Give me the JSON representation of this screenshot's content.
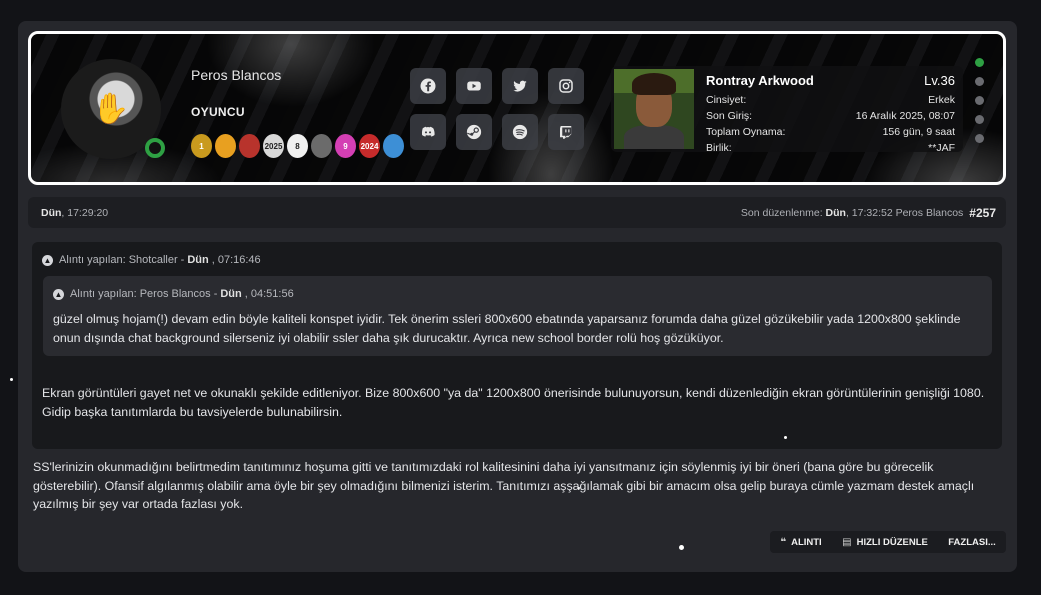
{
  "profile": {
    "username": "Peros Blancos",
    "rank": "OYUNCU",
    "badges": [
      {
        "color": "#c99a1e",
        "label": "1"
      },
      {
        "color": "#e8a020",
        "label": ""
      },
      {
        "color": "#b8332c",
        "label": ""
      },
      {
        "color": "#d8d8d8",
        "label": "2025"
      },
      {
        "color": "#f0f0f0",
        "label": "8"
      },
      {
        "color": "#6b6b6b",
        "label": ""
      },
      {
        "color": "#d43fb4",
        "label": "9"
      },
      {
        "color": "#c62b2b",
        "label": "2024"
      },
      {
        "color": "#3d8fd6",
        "label": ""
      }
    ]
  },
  "socials": [
    {
      "name": "facebook-icon"
    },
    {
      "name": "youtube-icon"
    },
    {
      "name": "twitter-icon"
    },
    {
      "name": "instagram-icon"
    },
    {
      "name": "discord-icon"
    },
    {
      "name": "steam-icon"
    },
    {
      "name": "spotify-icon"
    },
    {
      "name": "twitch-icon"
    }
  ],
  "character": {
    "name": "Rontray Arkwood",
    "level": "Lv.36",
    "rows": [
      {
        "label": "Cinsiyet:",
        "value": "Erkek"
      },
      {
        "label": "Son Giriş:",
        "value": "16 Aralık 2025, 08:07"
      },
      {
        "label": "Toplam Oynama:",
        "value": "156 gün, 9 saat"
      },
      {
        "label": "Birlik:",
        "value": "**JAF"
      }
    ]
  },
  "meta": {
    "date_bold": "Dün",
    "date_time": ", 17:29:20",
    "edited_label": "Son düzenlenme:",
    "edited_bold": "Dün",
    "edited_rest": ", 17:32:52 Peros Blancos",
    "post_number": "#257"
  },
  "quote_outer": {
    "prefix": "Alıntı yapılan: Shotcaller -",
    "bold": "Dün",
    "time": ", 07:16:46",
    "text": "Ekran görüntüleri gayet net ve okunaklı şekilde editleniyor. Bize 800x600 \"ya da\" 1200x800 önerisinde bulunuyorsun, kendi düzenlediğin ekran görüntülerinin genişliği 1080. Gidip başka tanıtımlarda bu tavsiyelerde bulunabilirsin."
  },
  "quote_inner": {
    "prefix": "Alıntı yapılan: Peros Blancos -",
    "bold": "Dün",
    "time": ", 04:51:56",
    "text": "güzel olmuş hojam(!) devam edin böyle kaliteli konspet iyidir. Tek önerim ssleri 800x600 ebatında yaparsanız forumda daha güzel gözükebilir yada 1200x800 şeklinde onun dışında chat background silerseniz iyi olabilir ssler daha şık durucaktır. Ayrıca new school border rolü hoş gözüküyor."
  },
  "reply": {
    "text": "SS'lerinizin okunmadığını belirtmedim tanıtımınız hoşuma gitti ve tanıtımızdaki rol kalitesinini daha iyi yansıtmanız için söylenmiş iyi bir öneri (bana göre bu görecelik gösterebilir). Ofansif algılanmış olabilir ama öyle bir şey olmadığını bilmenizi isterim. Tanıtımızı aşşağılamak gibi bir amacım olsa gelip buraya cümle yazmam destek amaçlı yazılmış bir şey var ortada fazlası yok."
  },
  "actions": {
    "quote": "ALINTI",
    "quick_edit": "HIZLI DÜZENLE",
    "more": "FAZLASI..."
  },
  "colors": {
    "online": "#2ea043",
    "accent_white": "#ffffff"
  }
}
